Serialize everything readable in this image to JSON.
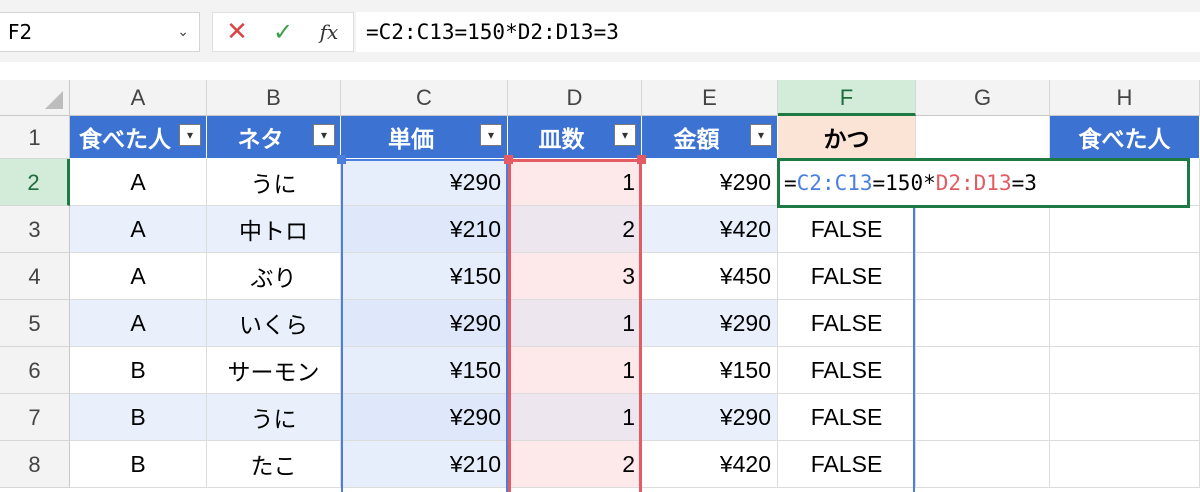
{
  "name_box": {
    "value": "F2"
  },
  "formula_bar": {
    "formula": "=C2:C13=150*D2:D13=3",
    "parts": [
      {
        "text": "=",
        "color": "#000000"
      },
      {
        "text": "C2:C13",
        "color": "#4a7fe0"
      },
      {
        "text": "=150*",
        "color": "#000000"
      },
      {
        "text": "D2:D13",
        "color": "#e35b63"
      },
      {
        "text": "=3",
        "color": "#000000"
      }
    ],
    "cancel_icon": "x-icon",
    "enter_icon": "check-icon",
    "fx_label": "fx"
  },
  "columns": [
    "A",
    "B",
    "C",
    "D",
    "E",
    "F",
    "G",
    "H"
  ],
  "active_column": "F",
  "rows": [
    "1",
    "2",
    "3",
    "4",
    "5",
    "6",
    "7",
    "8"
  ],
  "active_row": "2",
  "table_headers": [
    "食べた人",
    "ネタ",
    "単価",
    "皿数",
    "金額"
  ],
  "katsu_header": "かつ",
  "h_header": "食べた人",
  "data_rows": [
    {
      "a": "A",
      "b": "うに",
      "c": "¥290",
      "d": "1",
      "e": "¥290",
      "f": ""
    },
    {
      "a": "A",
      "b": "中トロ",
      "c": "¥210",
      "d": "2",
      "e": "¥420",
      "f": "FALSE"
    },
    {
      "a": "A",
      "b": "ぶり",
      "c": "¥150",
      "d": "3",
      "e": "¥450",
      "f": "FALSE"
    },
    {
      "a": "A",
      "b": "いくら",
      "c": "¥290",
      "d": "1",
      "e": "¥290",
      "f": "FALSE"
    },
    {
      "a": "B",
      "b": "サーモン",
      "c": "¥150",
      "d": "1",
      "e": "¥150",
      "f": "FALSE"
    },
    {
      "a": "B",
      "b": "うに",
      "c": "¥290",
      "d": "1",
      "e": "¥290",
      "f": "FALSE"
    },
    {
      "a": "B",
      "b": "たこ",
      "c": "¥210",
      "d": "2",
      "e": "¥420",
      "f": "FALSE"
    }
  ],
  "colors": {
    "table_header_bg": "#3c72d2",
    "katsu_header_bg": "#fbe3d5",
    "active_green": "#1e7a45",
    "range_c": "#4a7fe0",
    "range_d": "#e35b63"
  }
}
